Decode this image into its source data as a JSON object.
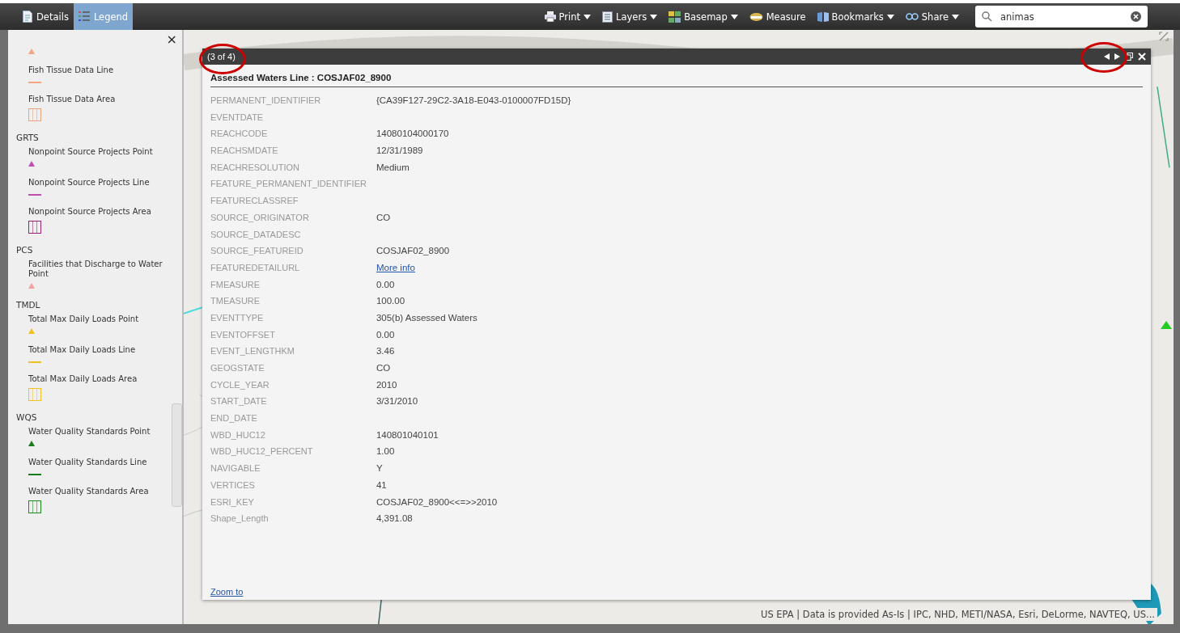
{
  "toolbar": {
    "tabs": [
      {
        "label": "Details",
        "selected": false
      },
      {
        "label": "Legend",
        "selected": true
      }
    ],
    "tools": [
      {
        "label": "Print",
        "dropdown": true
      },
      {
        "label": "Layers",
        "dropdown": true
      },
      {
        "label": "Basemap",
        "dropdown": true
      },
      {
        "label": "Measure",
        "dropdown": false
      },
      {
        "label": "Bookmarks",
        "dropdown": true
      },
      {
        "label": "Share",
        "dropdown": true
      }
    ],
    "search": {
      "value": "animas"
    }
  },
  "legend": {
    "close": "×",
    "groups": [
      {
        "items": [
          {
            "kind": "point",
            "color": "#f4a582"
          },
          {
            "label": "Fish Tissue Data Line",
            "kind": "line",
            "color": "#f4a582"
          },
          {
            "label": "Fish Tissue Data Area",
            "kind": "area",
            "color": "#e9a37f"
          }
        ]
      },
      {
        "title": "GRTS",
        "items": [
          {
            "label": "Nonpoint Source Projects Point",
            "kind": "point",
            "color": "#c050b0"
          },
          {
            "label": "Nonpoint Source Projects Line",
            "kind": "line",
            "color": "#c050b0"
          },
          {
            "label": "Nonpoint Source Projects Area",
            "kind": "area",
            "color": "#9a2070"
          }
        ]
      },
      {
        "title": "PCS",
        "items": [
          {
            "label": "Facilities that Discharge to Water Point",
            "kind": "point",
            "color": "#f2a0a0"
          }
        ]
      },
      {
        "title": "TMDL",
        "items": [
          {
            "label": "Total Max Daily Loads Point",
            "kind": "point",
            "color": "#f0c020"
          },
          {
            "label": "Total Max Daily Loads Line",
            "kind": "line",
            "color": "#f0c020"
          },
          {
            "label": "Total Max Daily Loads Area",
            "kind": "area",
            "color": "#f0c020"
          }
        ]
      },
      {
        "title": "WQS",
        "items": [
          {
            "label": "Water Quality Standards Point",
            "kind": "point",
            "color": "#1a7a1a"
          },
          {
            "label": "Water Quality Standards Line",
            "kind": "line",
            "color": "#1a7a1a"
          },
          {
            "label": "Water Quality Standards Area",
            "kind": "area",
            "color": "#1a8a1a"
          }
        ]
      }
    ]
  },
  "popup": {
    "counter": "(3 of 4)",
    "title": "Assessed Waters Line : COSJAF02_8900",
    "fields": [
      {
        "name": "PERMANENT_IDENTIFIER",
        "value": "{CA39F127-29C2-3A18-E043-0100007FD15D}"
      },
      {
        "name": "EVENTDATE"
      },
      {
        "name": "REACHCODE",
        "value": "14080104000170"
      },
      {
        "name": "REACHSMDATE",
        "value": "12/31/1989"
      },
      {
        "name": "REACHRESOLUTION",
        "value": "Medium"
      },
      {
        "name": "FEATURE_PERMANENT_IDENTIFIER"
      },
      {
        "name": "FEATURECLASSREF"
      },
      {
        "name": "SOURCE_ORIGINATOR",
        "value": "CO"
      },
      {
        "name": "SOURCE_DATADESC"
      },
      {
        "name": "SOURCE_FEATUREID",
        "value": "COSJAF02_8900"
      },
      {
        "name": "FEATUREDETAILURL",
        "value": "More info",
        "kind": "link"
      },
      {
        "name": "FMEASURE",
        "value": "0.00"
      },
      {
        "name": "TMEASURE",
        "value": "100.00"
      },
      {
        "name": "EVENTTYPE",
        "value": "305(b) Assessed Waters"
      },
      {
        "name": "EVENTOFFSET",
        "value": "0.00"
      },
      {
        "name": "EVENT_LENGTHKM",
        "value": "3.46"
      },
      {
        "name": "GEOGSTATE",
        "value": "CO"
      },
      {
        "name": "CYCLE_YEAR",
        "value": "2010"
      },
      {
        "name": "START_DATE",
        "value": "3/31/2010"
      },
      {
        "name": "END_DATE"
      },
      {
        "name": "WBD_HUC12",
        "value": "140801040101"
      },
      {
        "name": "WBD_HUC12_PERCENT",
        "value": "1.00"
      },
      {
        "name": "NAVIGABLE",
        "value": "Y"
      },
      {
        "name": "VERTICES",
        "value": "41"
      },
      {
        "name": "ESRI_KEY",
        "value": "COSJAF02_8900<<=>>2010"
      },
      {
        "name": "Shape_Length",
        "value": "4,391.08"
      }
    ],
    "zoom_link": "Zoom to"
  },
  "attribution": "US EPA | Data is provided As-Is | IPC, NHD, METI/NASA, Esri, DeLorme, NAVTEQ, US..."
}
